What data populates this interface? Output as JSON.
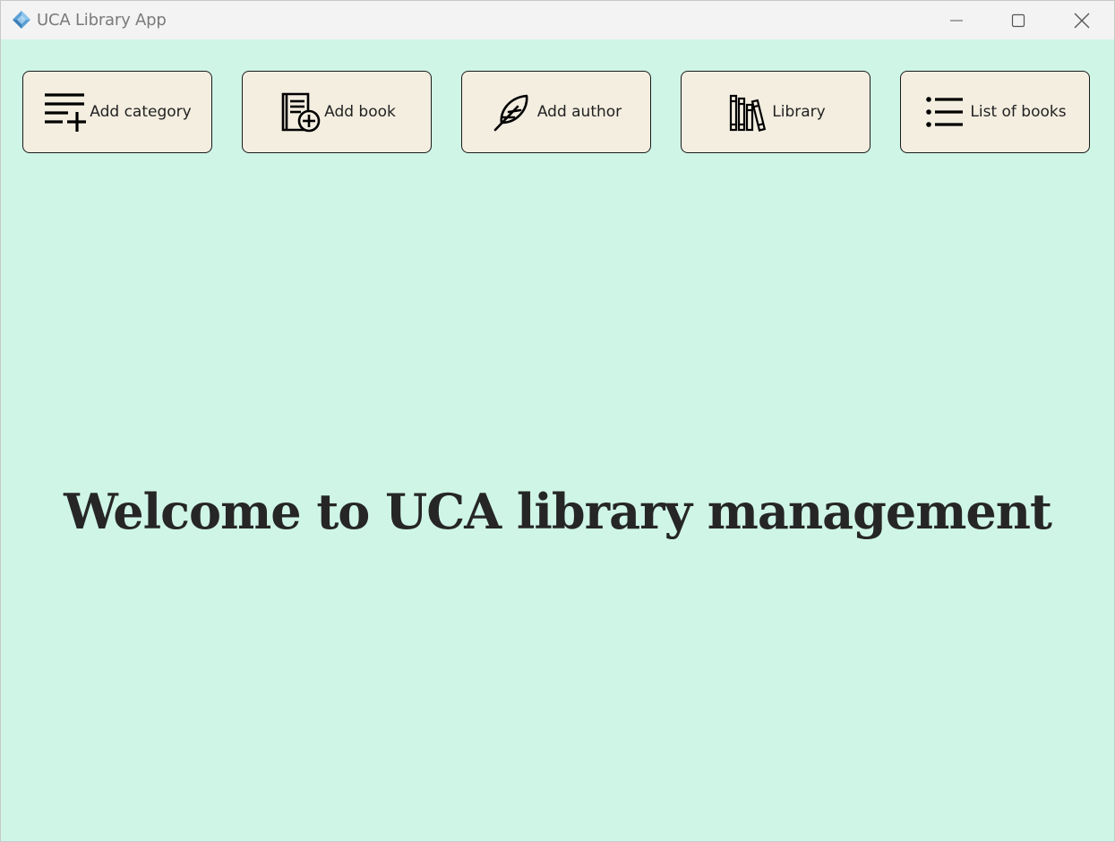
{
  "window": {
    "title": "UCA Library App",
    "background": "#cff5e7",
    "titlebar_background": "#f3f3f3"
  },
  "toolbar": {
    "button_background": "#f3eee0",
    "buttons": [
      {
        "label": "Add category",
        "icon": "add-list-icon"
      },
      {
        "label": "Add book",
        "icon": "add-book-icon"
      },
      {
        "label": "Add author",
        "icon": "feather-pen-icon"
      },
      {
        "label": "Library",
        "icon": "bookshelf-icon"
      },
      {
        "label": "List of books",
        "icon": "bulleted-list-icon"
      }
    ]
  },
  "main": {
    "welcome_text": "Welcome to UCA library management"
  }
}
